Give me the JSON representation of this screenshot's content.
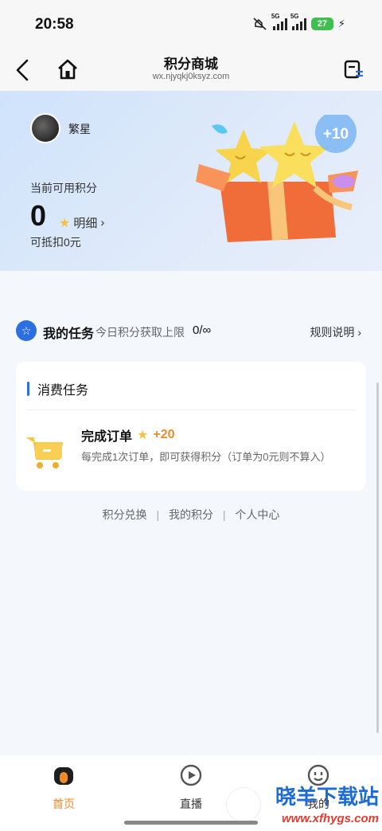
{
  "status_bar": {
    "time": "20:58",
    "network_1": "5G",
    "network_2": "5G",
    "battery": "27"
  },
  "nav": {
    "title": "积分商城",
    "url": "wx.njyqkj0ksyz.com"
  },
  "profile": {
    "username": "繁星",
    "points_label": "当前可用积分",
    "points_value": "0",
    "detail_label": "明细",
    "deduct_text": "可抵扣0元",
    "bubble_text": "+10"
  },
  "tasks": {
    "title": "我的任务",
    "limit_label": "今日积分获取上限",
    "limit_value": "0/∞",
    "rules_label": "规则说明"
  },
  "card": {
    "section_title": "消费任务",
    "task_name": "完成订单",
    "task_bonus": "+20",
    "task_desc": "每完成1次订单，即可获得积分（订单为0元则不算入）"
  },
  "footer_links": {
    "exchange": "积分兑换",
    "my_points": "我的积分",
    "personal_center": "个人中心",
    "separator": "|"
  },
  "tab_bar": {
    "home": "首页",
    "live": "直播",
    "mine": "我的"
  },
  "watermark": {
    "name": "晓羊下载站",
    "url": "www.xfhygs.com"
  },
  "colors": {
    "accent_blue": "#2c6fe0",
    "accent_orange": "#f08b2a",
    "star_yellow": "#f3c242"
  }
}
